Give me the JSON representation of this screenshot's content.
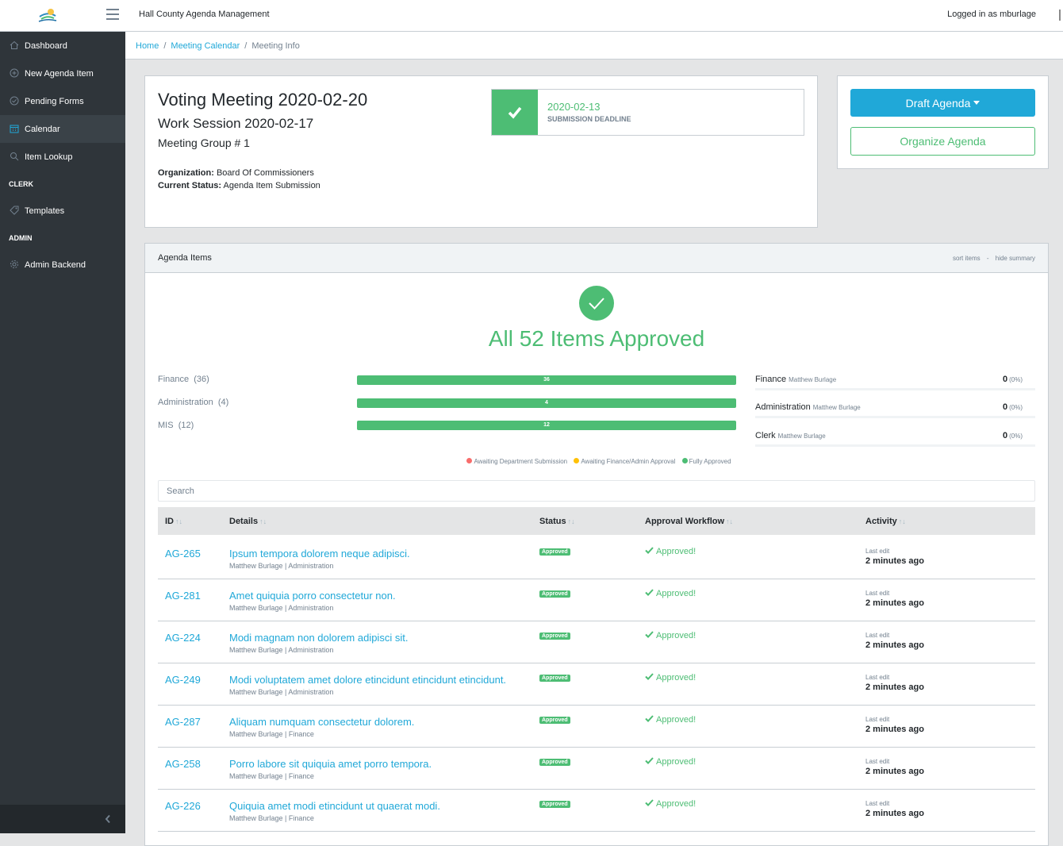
{
  "header": {
    "app_title": "Hall County Agenda Management",
    "logged_in": "Logged in as mburlage"
  },
  "sidebar": {
    "items": [
      {
        "label": "Dashboard",
        "icon": "home-icon"
      },
      {
        "label": "New Agenda Item",
        "icon": "plus-circle-icon"
      },
      {
        "label": "Pending Forms",
        "icon": "check-circle-icon"
      },
      {
        "label": "Calendar",
        "icon": "calendar-icon",
        "active": true
      },
      {
        "label": "Item Lookup",
        "icon": "search-icon"
      }
    ],
    "section_clerk": "CLERK",
    "templates": "Templates",
    "section_admin": "ADMIN",
    "admin_backend": "Admin Backend"
  },
  "breadcrumb": {
    "home": "Home",
    "calendar": "Meeting Calendar",
    "current": "Meeting Info"
  },
  "meeting": {
    "title": "Voting Meeting 2020-02-20",
    "work_session": "Work Session 2020-02-17",
    "group": "Meeting Group # 1",
    "org_label": "Organization:",
    "org_value": "Board Of Commissioners",
    "status_label": "Current Status:",
    "status_value": "Agenda Item Submission",
    "deadline_date": "2020-02-13",
    "deadline_label": "SUBMISSION DEADLINE"
  },
  "actions": {
    "draft": "Draft Agenda",
    "organize": "Organize Agenda"
  },
  "agenda_items": {
    "title": "Agenda Items",
    "sort": "sort items",
    "dash": "-",
    "hide": "hide summary",
    "headline": "All 52 Items Approved",
    "categories": [
      {
        "name": "Finance",
        "count": "(36)",
        "bar": "36",
        "fraction": 1.0
      },
      {
        "name": "Administration",
        "count": "(4)",
        "bar": "4",
        "fraction": 1.0
      },
      {
        "name": "MIS",
        "count": "(12)",
        "bar": "12",
        "fraction": 1.0
      }
    ],
    "approvers": [
      {
        "dept": "Finance",
        "person": "Matthew Burlage",
        "num": "0",
        "pct": "(0%)"
      },
      {
        "dept": "Administration",
        "person": "Matthew Burlage",
        "num": "0",
        "pct": "(0%)"
      },
      {
        "dept": "Clerk",
        "person": "Matthew Burlage",
        "num": "0",
        "pct": "(0%)"
      }
    ],
    "legend": {
      "red": "Awaiting Department Submission",
      "yellow": "Awaiting Finance/Admin Approval",
      "green": "Fully Approved"
    },
    "search_placeholder": "Search",
    "columns": {
      "id": "ID",
      "details": "Details",
      "status": "Status",
      "workflow": "Approval Workflow",
      "activity": "Activity"
    },
    "sort_glyph": "↑↓",
    "rows": [
      {
        "id": "AG-265",
        "title": "Ipsum tempora dolorem neque adipisci.",
        "meta": "Matthew Burlage | Administration",
        "status": "Approved",
        "workflow": "Approved!",
        "edit": "Last edit",
        "ago": "2 minutes ago"
      },
      {
        "id": "AG-281",
        "title": "Amet quiquia porro consectetur non.",
        "meta": "Matthew Burlage | Administration",
        "status": "Approved",
        "workflow": "Approved!",
        "edit": "Last edit",
        "ago": "2 minutes ago"
      },
      {
        "id": "AG-224",
        "title": "Modi magnam non dolorem adipisci sit.",
        "meta": "Matthew Burlage | Administration",
        "status": "Approved",
        "workflow": "Approved!",
        "edit": "Last edit",
        "ago": "2 minutes ago"
      },
      {
        "id": "AG-249",
        "title": "Modi voluptatem amet dolore etincidunt etincidunt etincidunt.",
        "meta": "Matthew Burlage | Administration",
        "status": "Approved",
        "workflow": "Approved!",
        "edit": "Last edit",
        "ago": "2 minutes ago"
      },
      {
        "id": "AG-287",
        "title": "Aliquam numquam consectetur dolorem.",
        "meta": "Matthew Burlage | Finance",
        "status": "Approved",
        "workflow": "Approved!",
        "edit": "Last edit",
        "ago": "2 minutes ago"
      },
      {
        "id": "AG-258",
        "title": "Porro labore sit quiquia amet porro tempora.",
        "meta": "Matthew Burlage | Finance",
        "status": "Approved",
        "workflow": "Approved!",
        "edit": "Last edit",
        "ago": "2 minutes ago"
      },
      {
        "id": "AG-226",
        "title": "Quiquia amet modi etincidunt ut quaerat modi.",
        "meta": "Matthew Burlage | Finance",
        "status": "Approved",
        "workflow": "Approved!",
        "edit": "Last edit",
        "ago": "2 minutes ago"
      }
    ]
  },
  "colors": {
    "green": "#4dbd74",
    "blue": "#20a8d8",
    "sidebar": "#2f353a",
    "red": "#f86c6b",
    "yellow": "#ffc107"
  }
}
